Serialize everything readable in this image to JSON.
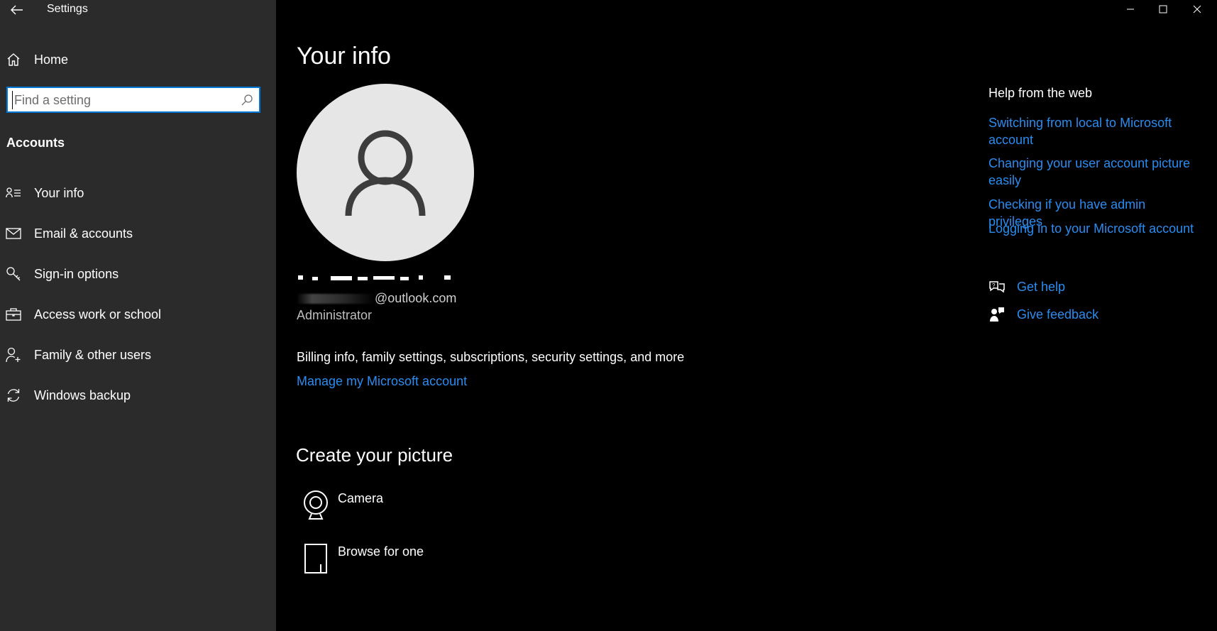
{
  "app": {
    "title": "Settings"
  },
  "sidebar": {
    "home_label": "Home",
    "search_placeholder": "Find a setting",
    "section_heading": "Accounts",
    "items": [
      {
        "label": "Your info",
        "icon": "contact-info-icon",
        "selected": true
      },
      {
        "label": "Email & accounts",
        "icon": "mail-icon"
      },
      {
        "label": "Sign-in options",
        "icon": "key-icon"
      },
      {
        "label": "Access work or school",
        "icon": "briefcase-icon"
      },
      {
        "label": "Family & other users",
        "icon": "add-user-icon"
      },
      {
        "label": "Windows backup",
        "icon": "sync-icon"
      }
    ]
  },
  "main": {
    "title": "Your info",
    "email_visible_part": "@outlook.com",
    "role": "Administrator",
    "billing_text": "Billing info, family settings, subscriptions, security settings, and more",
    "manage_link": "Manage my Microsoft account",
    "create_picture_title": "Create your picture",
    "picture_options": [
      {
        "label": "Camera",
        "icon": "camera-icon"
      },
      {
        "label": "Browse for one",
        "icon": "document-icon"
      }
    ]
  },
  "help": {
    "heading": "Help from the web",
    "links": [
      "Switching from local to Microsoft account",
      "Changing your user account picture easily",
      "Checking if you have admin privileges",
      "Logging in to your Microsoft account"
    ],
    "get_help": "Get help",
    "give_feedback": "Give feedback"
  },
  "colors": {
    "accent": "#0078d7",
    "link": "#2b8cf0",
    "sidebar_bg": "#2b2b2b",
    "content_bg": "#000000"
  }
}
